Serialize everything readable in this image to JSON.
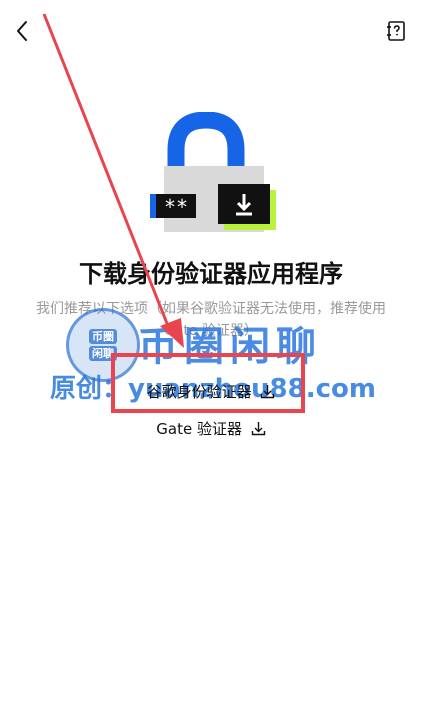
{
  "header": {
    "back_icon": "chevron-left-icon",
    "help_icon": "help-book-icon"
  },
  "hero": {
    "illustration": "padlock-download-icon",
    "password_mask": "**"
  },
  "main": {
    "title": "下载身份验证器应用程序",
    "subtitle": "我们推荐以下选项（如果谷歌验证器无法使用，推荐使用 Gate 验证器）"
  },
  "links": [
    {
      "label": "谷歌身份验证器",
      "icon": "download-icon"
    },
    {
      "label": "Gate 验证器",
      "icon": "download-icon"
    }
  ],
  "watermark": {
    "badge_line1": "币圈",
    "badge_line2": "闲聊",
    "title": "币圈闲聊",
    "site": "原创：yuanzhou88.com"
  },
  "colors": {
    "lock_shackle": "#1565e6",
    "lock_body": "#d9d9d9",
    "panel_dark": "#111111",
    "accent_green": "#b8f23a",
    "annotation_red": "#e8454f"
  }
}
